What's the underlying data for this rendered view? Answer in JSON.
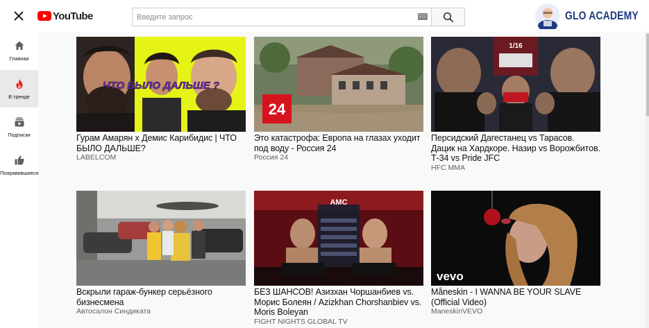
{
  "header": {
    "logo_text": "YouTube",
    "search_placeholder": "Введите запрос",
    "search_value": "",
    "brand_text": "GLO ACADEMY"
  },
  "sidebar": {
    "items": [
      {
        "label": "Главная",
        "icon": "home-icon",
        "active": false
      },
      {
        "label": "В тренде",
        "icon": "fire-icon",
        "active": true
      },
      {
        "label": "Подписки",
        "icon": "subscriptions-icon",
        "active": false
      },
      {
        "label": "Понравившиеся",
        "icon": "thumb-up-icon",
        "active": false
      }
    ]
  },
  "videos": [
    {
      "title": "Гурам Амарян х Демис Карибидис | ЧТО БЫЛО ДАЛЬШЕ?",
      "channel": "LABELCOM",
      "thumb_text": "ЧТО БЫЛО ДАЛЬШЕ ?"
    },
    {
      "title": "Это катастрофа: Европа на глазах уходит под воду - Россия 24",
      "channel": "Россия 24",
      "thumb_text": "24"
    },
    {
      "title": "Персидский Дагестанец vs Тарасов. Дацик на Хардкоре. Назир vs Ворожбитов. Т-34 vs Pride JFC",
      "channel": "HFC MMA",
      "thumb_text": "1/16"
    },
    {
      "title": "Вскрыли гараж-бункер серьёзного бизнесмена",
      "channel": "Автосалон Синдиката",
      "thumb_text": ""
    },
    {
      "title": "БЕЗ ШАНСОВ! Азизхан Чоршанбиев vs. Морис Болеян / Azizkhan Chorshanbiev vs. Moris Boleyan",
      "channel": "FIGHT NIGHTS GLOBAL TV",
      "thumb_text": "AMC"
    },
    {
      "title": "Måneskin - I WANNA BE YOUR SLAVE (Official Video)",
      "channel": "ManeskinVEVO",
      "thumb_text": "vevo"
    }
  ],
  "colors": {
    "youtube_red": "#ff0000",
    "sidebar_active": "#e9e9e9",
    "main_bg": "#f9f9f9",
    "brand_blue": "#1d3a82"
  }
}
